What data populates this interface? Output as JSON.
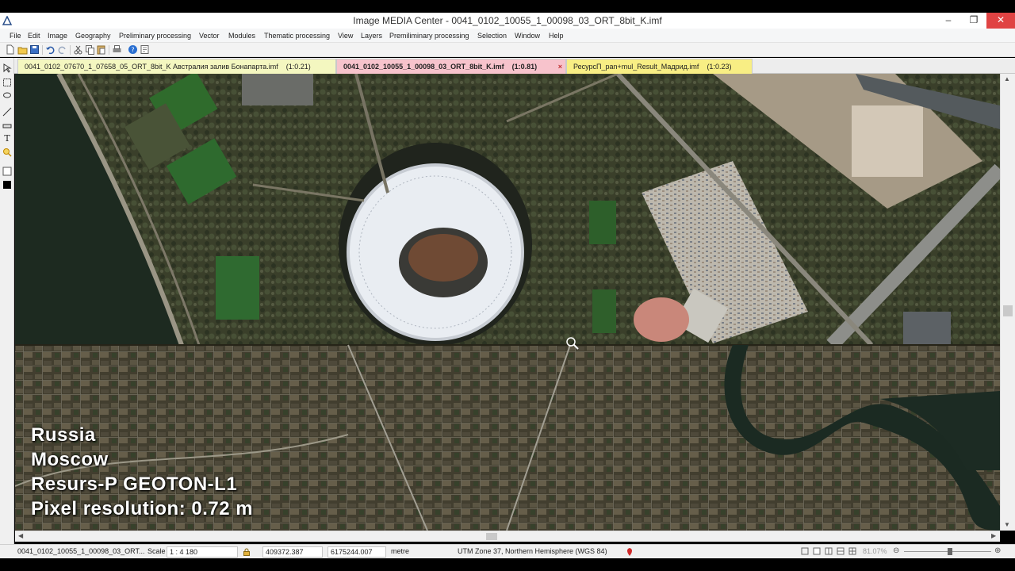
{
  "window": {
    "title": "Image MEDIA Center - 0041_0102_10055_1_00098_03_ORT_8bit_K.imf",
    "buttons": [
      "minimize",
      "maximize",
      "close"
    ]
  },
  "menu": [
    "File",
    "Edit",
    "Image",
    "Geography",
    "Preliminary processing",
    "Vector",
    "Modules",
    "Thematic processing",
    "View",
    "Layers",
    "Premiliminary processing",
    "Selection",
    "Window",
    "Help"
  ],
  "tabs": [
    {
      "label": "0041_0102_07670_1_07658_05_ORT_8bit_K Австралия залив Бонапарта.imf",
      "zoom": "(1:0.21)"
    },
    {
      "label": "0041_0102_10055_1_00098_03_ORT_8bit_K.imf",
      "zoom": "(1:0.81)",
      "close": "×"
    },
    {
      "label": "РесурсП_pan+mul_Result_Мадрид.imf",
      "zoom": "(1:0.23)"
    }
  ],
  "overlay": {
    "line1": "Russia",
    "line2": "Moscow",
    "line3": "Resurs-P GEOTON-L1",
    "line4": "Pixel resolution: 0.72 m"
  },
  "status": {
    "file": "0041_0102_10055_1_00098_03_ORT...",
    "scale_label": "Scale",
    "scale_value": "1 : 4 180",
    "x_coord": "409372.387",
    "y_coord": "6175244.007",
    "units": "metre",
    "projection": "UTM Zone 37, Northern Hemisphere (WGS 84)",
    "zoom": "81.07%"
  },
  "colors": {
    "tab_active": "#f7c3cc",
    "tab_1": "#f4f7c0",
    "tab_3": "#f8ee84",
    "close_button": "#e04343"
  }
}
